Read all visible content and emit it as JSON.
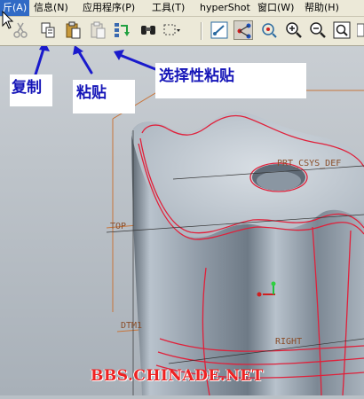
{
  "menubar": {
    "items": [
      {
        "label": "文件(A)",
        "visible_label": "斤(A)"
      },
      {
        "label": "信息(N)"
      },
      {
        "label": "应用程序(P)"
      },
      {
        "label": "工具(T)"
      },
      {
        "label": "hyperShot"
      },
      {
        "label": "窗口(W)"
      },
      {
        "label": "帮助(H)"
      }
    ]
  },
  "toolbar": {
    "buttons": [
      "cut-icon",
      "copy-icon",
      "paste-icon",
      "paste-special-icon",
      "regenerate-icon",
      "find-icon",
      "select-box-icon",
      "datum-planes-icon",
      "datum-axis-icon",
      "spin-center-icon",
      "zoom-in-icon",
      "zoom-out-icon",
      "refit-icon"
    ]
  },
  "callouts": {
    "copy": "复制",
    "paste": "粘贴",
    "paste_special": "选择性粘贴"
  },
  "viewport": {
    "datum_labels": {
      "csys": "PRT_CSYS_DEF",
      "top": "TOP",
      "dtm": "DTM1",
      "right": "RIGHT"
    }
  },
  "watermark": "BBS.CHINADE.NET",
  "colors": {
    "menubar_bg": "#ece9d8",
    "menu_highlight": "#316ac5",
    "callout_text": "#1616b8",
    "model_edges": "#e0203a",
    "datum_color": "#c8753a",
    "part_fill": "#9aa6b2"
  }
}
